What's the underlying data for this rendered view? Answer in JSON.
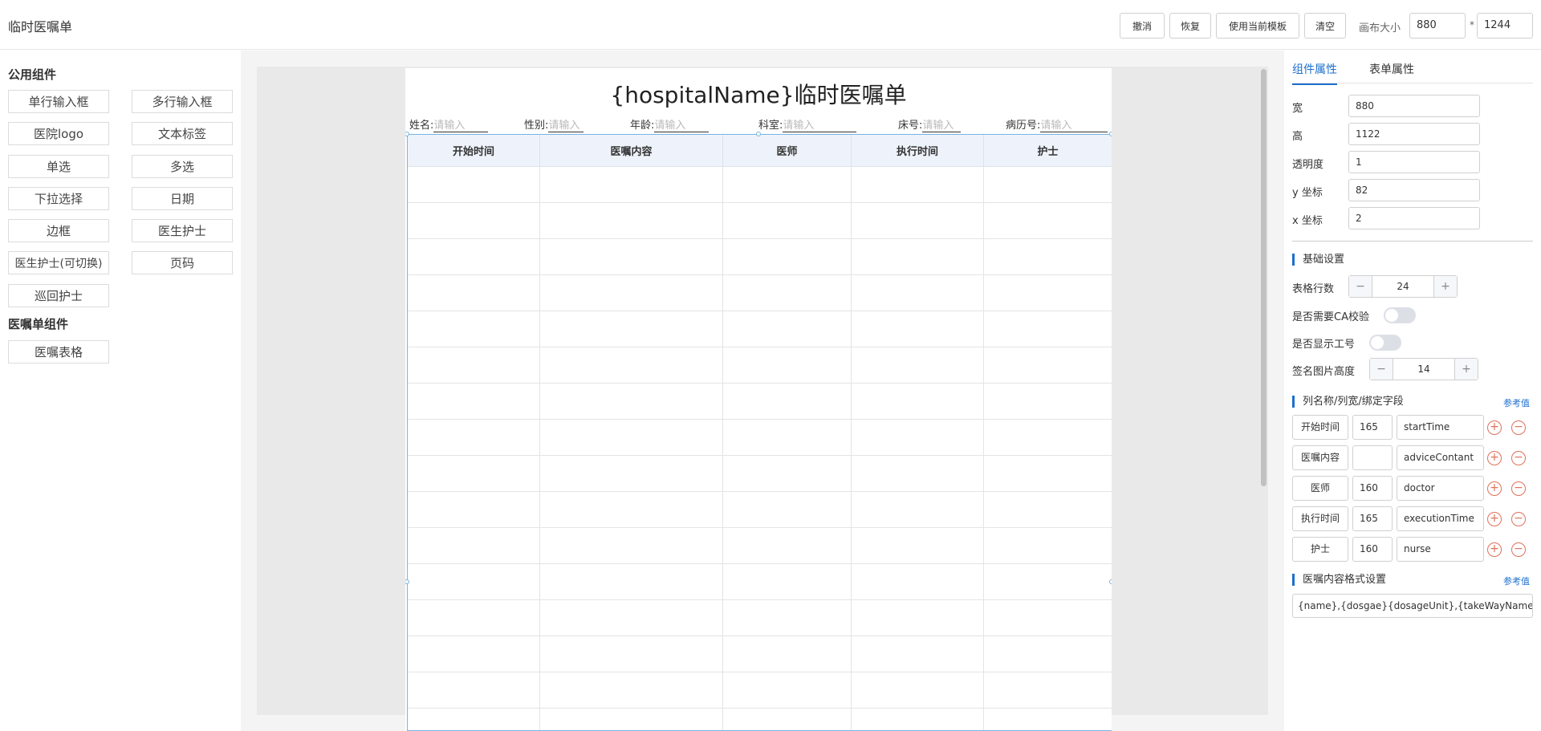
{
  "app": {
    "title": "临时医嘱单"
  },
  "toolbar": {
    "undo": "撤消",
    "redo": "恢复",
    "use_template": "使用当前模板",
    "clear": "清空",
    "canvas_size_label": "画布大小",
    "canvas_width": "880",
    "canvas_sep": "*",
    "canvas_height": "1244"
  },
  "left": {
    "common_title": "公用组件",
    "common_items": [
      "单行输入框",
      "多行输入框",
      "医院logo",
      "文本标签",
      "单选",
      "多选",
      "下拉选择",
      "日期",
      "边框",
      "医生护士",
      "医生护士(可切换)",
      "页码",
      "巡回护士"
    ],
    "advice_title": "医嘱单组件",
    "advice_items": [
      "医嘱表格"
    ]
  },
  "paper": {
    "title": "{hospitalName}临时医嘱单",
    "fields": [
      {
        "label": "姓名:",
        "placeholder": "请输入"
      },
      {
        "label": "性别:",
        "placeholder": "请输入"
      },
      {
        "label": "年龄:",
        "placeholder": "请输入"
      },
      {
        "label": "科室:",
        "placeholder": "请输入"
      },
      {
        "label": "床号:",
        "placeholder": "请输入"
      },
      {
        "label": "病历号:",
        "placeholder": "请输入"
      }
    ],
    "table_headers": [
      "开始时间",
      "医嘱内容",
      "医师",
      "执行时间",
      "护士"
    ]
  },
  "right": {
    "tabs": [
      "组件属性",
      "表单属性"
    ],
    "props": [
      {
        "label": "宽",
        "value": "880"
      },
      {
        "label": "高",
        "value": "1122"
      },
      {
        "label": "透明度",
        "value": "1"
      },
      {
        "label": "y 坐标",
        "value": "82"
      },
      {
        "label": "x 坐标",
        "value": "2"
      }
    ],
    "basic_title": "基础设置",
    "row_count_label": "表格行数",
    "row_count": "24",
    "ca_label": "是否需要CA校验",
    "show_id_label": "是否显示工号",
    "sign_height_label": "签名图片高度",
    "sign_height": "14",
    "columns_title": "列名称/列宽/绑定字段",
    "ref_link": "参考值",
    "columns": [
      {
        "name": "开始时间",
        "width": "165",
        "field": "startTime"
      },
      {
        "name": "医嘱内容",
        "width": "",
        "field": "adviceContant"
      },
      {
        "name": "医师",
        "width": "160",
        "field": "doctor"
      },
      {
        "name": "执行时间",
        "width": "165",
        "field": "executionTime"
      },
      {
        "name": "护士",
        "width": "160",
        "field": "nurse"
      }
    ],
    "format_title": "医嘱内容格式设置",
    "format_ref_link": "参考值",
    "format_value": "{name},{dosgae}{dosageUnit},{takeWayName},{fre"
  },
  "colors": {
    "accent": "#1d6fce",
    "danger": "#e0705a",
    "selection": "#74b4e4"
  }
}
